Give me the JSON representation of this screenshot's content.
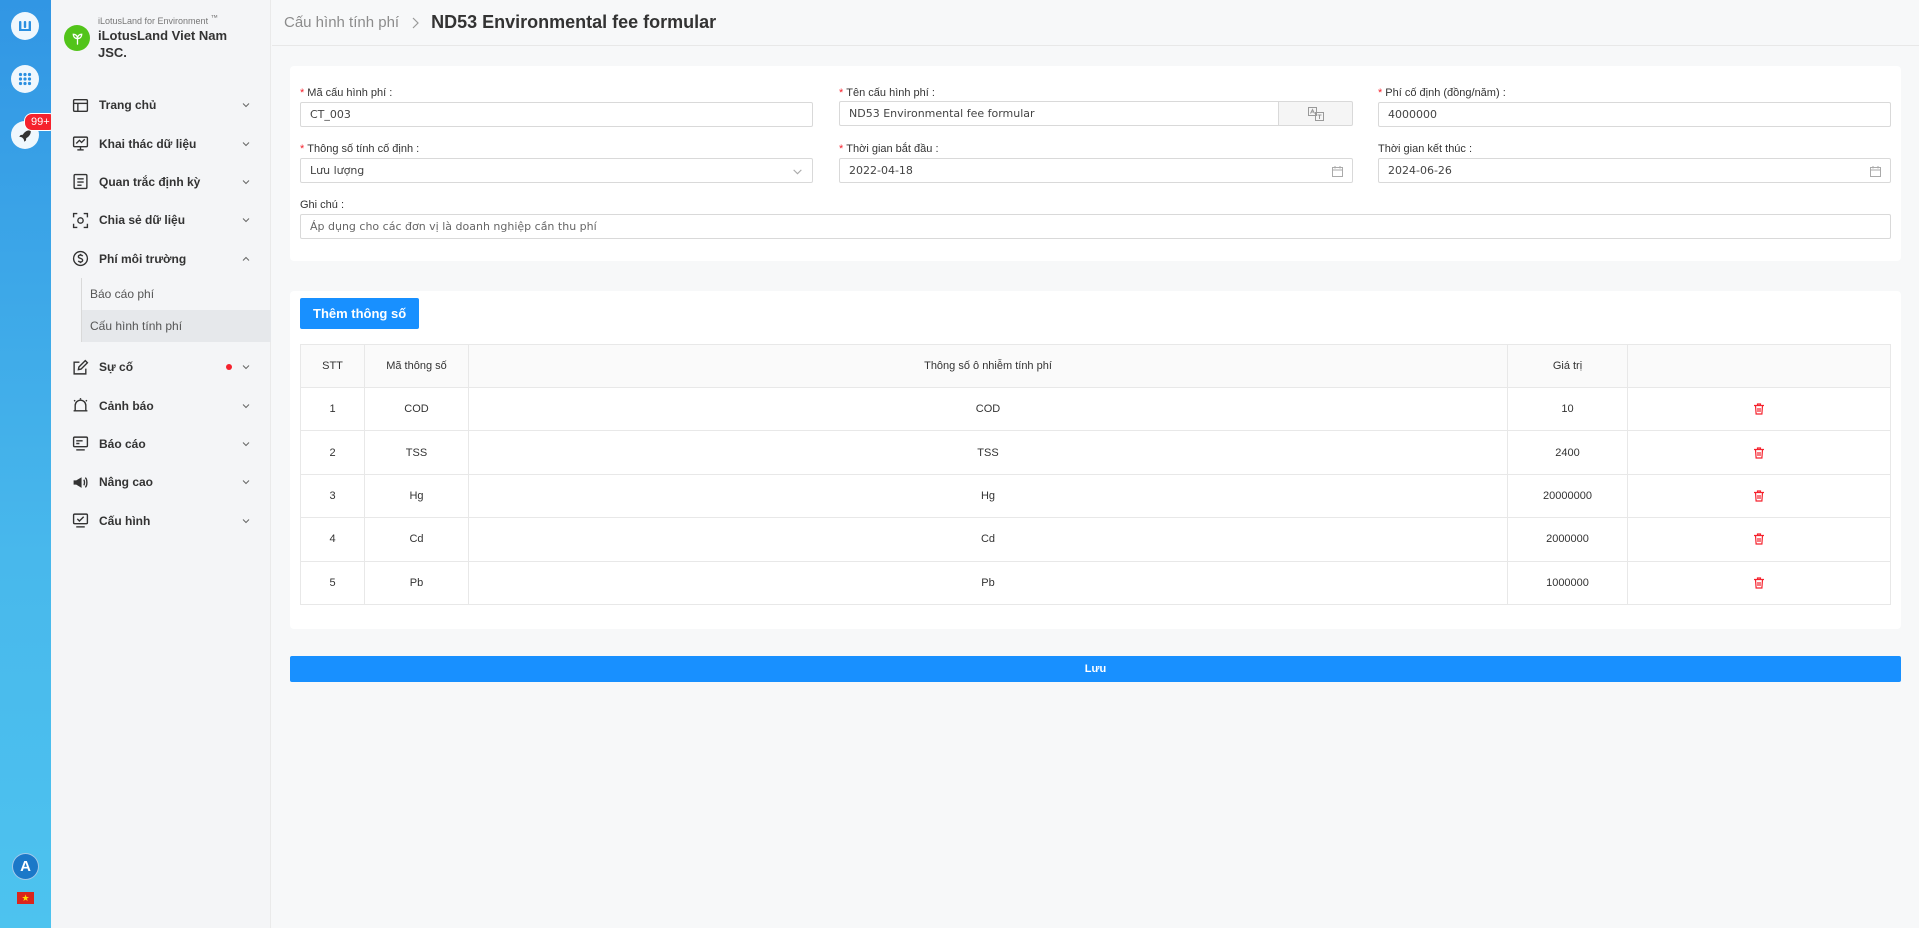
{
  "rail": {
    "notification_count": "99+",
    "avatar_letter": "A",
    "flag_star": "★"
  },
  "brand": {
    "subtitle": "iLotusLand for Environment",
    "subtitle_mark": "™",
    "name": "iLotusLand Viet Nam JSC."
  },
  "menu": [
    {
      "label": "Trang chủ",
      "icon": "home-icon"
    },
    {
      "label": "Khai thác dữ liệu",
      "icon": "monitor-data-icon"
    },
    {
      "label": "Quan trắc định kỳ",
      "icon": "report-list-icon"
    },
    {
      "label": "Chia sẻ dữ liệu",
      "icon": "share-data-icon"
    },
    {
      "label": "Phí môi trường",
      "icon": "dollar-circle-icon",
      "expanded": true,
      "children": [
        {
          "label": "Báo cáo phí"
        },
        {
          "label": "Cấu hình tính phí",
          "active": true
        }
      ]
    },
    {
      "label": "Sự cố",
      "icon": "edit-icon",
      "has_alert": true
    },
    {
      "label": "Cảnh báo",
      "icon": "alarm-bell-icon"
    },
    {
      "label": "Báo cáo",
      "icon": "report-monitor-icon"
    },
    {
      "label": "Nâng cao",
      "icon": "megaphone-icon"
    },
    {
      "label": "Cấu hình",
      "icon": "settings-monitor-icon"
    }
  ],
  "header": {
    "breadcrumb": "Cấu hình tính phí",
    "title": "ND53 Environmental fee formular"
  },
  "form": {
    "code": {
      "label": "Mã cấu hình phí",
      "value": "CT_003",
      "required": true
    },
    "name": {
      "label": "Tên cấu hình phí",
      "value": "ND53 Environmental fee formular",
      "required": true
    },
    "fixed_fee": {
      "label": "Phí cố định (đồng/năm)",
      "value": "4000000",
      "required": true
    },
    "fixed_param": {
      "label": "Thông số tính cố định",
      "value": "Lưu lượng",
      "required": true
    },
    "start_date": {
      "label": "Thời gian bắt đầu",
      "value": "2022-04-18",
      "required": true
    },
    "end_date": {
      "label": "Thời gian kết thúc",
      "value": "2024-06-26",
      "required": false
    },
    "note": {
      "label": "Ghi chú",
      "placeholder": "Áp dụng cho các đơn vị là doanh nghiệp cần thu phí"
    }
  },
  "add_button": "Thêm thông số",
  "table": {
    "headers": [
      "STT",
      "Mã thông số",
      "Thông số ô nhiễm tính phí",
      "Giá trị",
      ""
    ],
    "rows": [
      {
        "stt": "1",
        "code": "COD",
        "param": "COD",
        "value": "10"
      },
      {
        "stt": "2",
        "code": "TSS",
        "param": "TSS",
        "value": "2400"
      },
      {
        "stt": "3",
        "code": "Hg",
        "param": "Hg",
        "value": "20000000"
      },
      {
        "stt": "4",
        "code": "Cd",
        "param": "Cd",
        "value": "2000000"
      },
      {
        "stt": "5",
        "code": "Pb",
        "param": "Pb",
        "value": "1000000"
      }
    ]
  },
  "save_button": "Lưu",
  "colors": {
    "primary": "#1890ff",
    "danger": "#f5222d",
    "brand_green": "#52c41a",
    "rail_top": "#3196e4",
    "rail_bottom": "#4dc3ef"
  }
}
